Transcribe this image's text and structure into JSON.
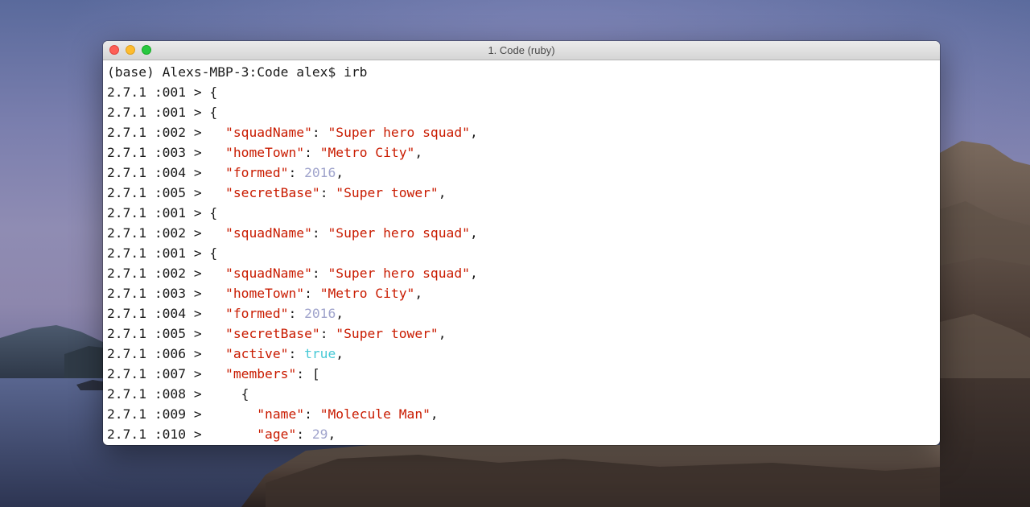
{
  "window": {
    "title": "1. Code (ruby)"
  },
  "colors": {
    "string": "#c91b00",
    "number": "#a0a4cc",
    "boolean": "#48c9d6",
    "text": "#1a1a1a"
  },
  "terminal": {
    "lines": [
      {
        "segments": [
          {
            "t": "(base) Alexs-MBP-3:Code alex$ irb",
            "k": "plain"
          }
        ]
      },
      {
        "segments": [
          {
            "t": "2.7.1 :001 > {",
            "k": "plain"
          }
        ]
      },
      {
        "segments": [
          {
            "t": "2.7.1 :001 > {",
            "k": "plain"
          }
        ]
      },
      {
        "segments": [
          {
            "t": "2.7.1 :002 >   ",
            "k": "plain"
          },
          {
            "t": "\"squadName\"",
            "k": "str"
          },
          {
            "t": ": ",
            "k": "plain"
          },
          {
            "t": "\"Super hero squad\"",
            "k": "str"
          },
          {
            "t": ",",
            "k": "plain"
          }
        ]
      },
      {
        "segments": [
          {
            "t": "2.7.1 :003 >   ",
            "k": "plain"
          },
          {
            "t": "\"homeTown\"",
            "k": "str"
          },
          {
            "t": ": ",
            "k": "plain"
          },
          {
            "t": "\"Metro City\"",
            "k": "str"
          },
          {
            "t": ",",
            "k": "plain"
          }
        ]
      },
      {
        "segments": [
          {
            "t": "2.7.1 :004 >   ",
            "k": "plain"
          },
          {
            "t": "\"formed\"",
            "k": "str"
          },
          {
            "t": ": ",
            "k": "plain"
          },
          {
            "t": "2016",
            "k": "num"
          },
          {
            "t": ",",
            "k": "plain"
          }
        ]
      },
      {
        "segments": [
          {
            "t": "2.7.1 :005 >   ",
            "k": "plain"
          },
          {
            "t": "\"secretBase\"",
            "k": "str"
          },
          {
            "t": ": ",
            "k": "plain"
          },
          {
            "t": "\"Super tower\"",
            "k": "str"
          },
          {
            "t": ",",
            "k": "plain"
          }
        ]
      },
      {
        "segments": [
          {
            "t": "2.7.1 :001 > {",
            "k": "plain"
          }
        ]
      },
      {
        "segments": [
          {
            "t": "2.7.1 :002 >   ",
            "k": "plain"
          },
          {
            "t": "\"squadName\"",
            "k": "str"
          },
          {
            "t": ": ",
            "k": "plain"
          },
          {
            "t": "\"Super hero squad\"",
            "k": "str"
          },
          {
            "t": ",",
            "k": "plain"
          }
        ]
      },
      {
        "segments": [
          {
            "t": "2.7.1 :001 > {",
            "k": "plain"
          }
        ]
      },
      {
        "segments": [
          {
            "t": "2.7.1 :002 >   ",
            "k": "plain"
          },
          {
            "t": "\"squadName\"",
            "k": "str"
          },
          {
            "t": ": ",
            "k": "plain"
          },
          {
            "t": "\"Super hero squad\"",
            "k": "str"
          },
          {
            "t": ",",
            "k": "plain"
          }
        ]
      },
      {
        "segments": [
          {
            "t": "2.7.1 :003 >   ",
            "k": "plain"
          },
          {
            "t": "\"homeTown\"",
            "k": "str"
          },
          {
            "t": ": ",
            "k": "plain"
          },
          {
            "t": "\"Metro City\"",
            "k": "str"
          },
          {
            "t": ",",
            "k": "plain"
          }
        ]
      },
      {
        "segments": [
          {
            "t": "2.7.1 :004 >   ",
            "k": "plain"
          },
          {
            "t": "\"formed\"",
            "k": "str"
          },
          {
            "t": ": ",
            "k": "plain"
          },
          {
            "t": "2016",
            "k": "num"
          },
          {
            "t": ",",
            "k": "plain"
          }
        ]
      },
      {
        "segments": [
          {
            "t": "2.7.1 :005 >   ",
            "k": "plain"
          },
          {
            "t": "\"secretBase\"",
            "k": "str"
          },
          {
            "t": ": ",
            "k": "plain"
          },
          {
            "t": "\"Super tower\"",
            "k": "str"
          },
          {
            "t": ",",
            "k": "plain"
          }
        ]
      },
      {
        "segments": [
          {
            "t": "2.7.1 :006 >   ",
            "k": "plain"
          },
          {
            "t": "\"active\"",
            "k": "str"
          },
          {
            "t": ": ",
            "k": "plain"
          },
          {
            "t": "true",
            "k": "bool"
          },
          {
            "t": ",",
            "k": "plain"
          }
        ]
      },
      {
        "segments": [
          {
            "t": "2.7.1 :007 >   ",
            "k": "plain"
          },
          {
            "t": "\"members\"",
            "k": "str"
          },
          {
            "t": ": [",
            "k": "plain"
          }
        ]
      },
      {
        "segments": [
          {
            "t": "2.7.1 :008 >     {",
            "k": "plain"
          }
        ]
      },
      {
        "segments": [
          {
            "t": "2.7.1 :009 >       ",
            "k": "plain"
          },
          {
            "t": "\"name\"",
            "k": "str"
          },
          {
            "t": ": ",
            "k": "plain"
          },
          {
            "t": "\"Molecule Man\"",
            "k": "str"
          },
          {
            "t": ",",
            "k": "plain"
          }
        ]
      },
      {
        "segments": [
          {
            "t": "2.7.1 :010 >       ",
            "k": "plain"
          },
          {
            "t": "\"age\"",
            "k": "str"
          },
          {
            "t": ": ",
            "k": "plain"
          },
          {
            "t": "29",
            "k": "num"
          },
          {
            "t": ",",
            "k": "plain"
          }
        ]
      }
    ]
  }
}
